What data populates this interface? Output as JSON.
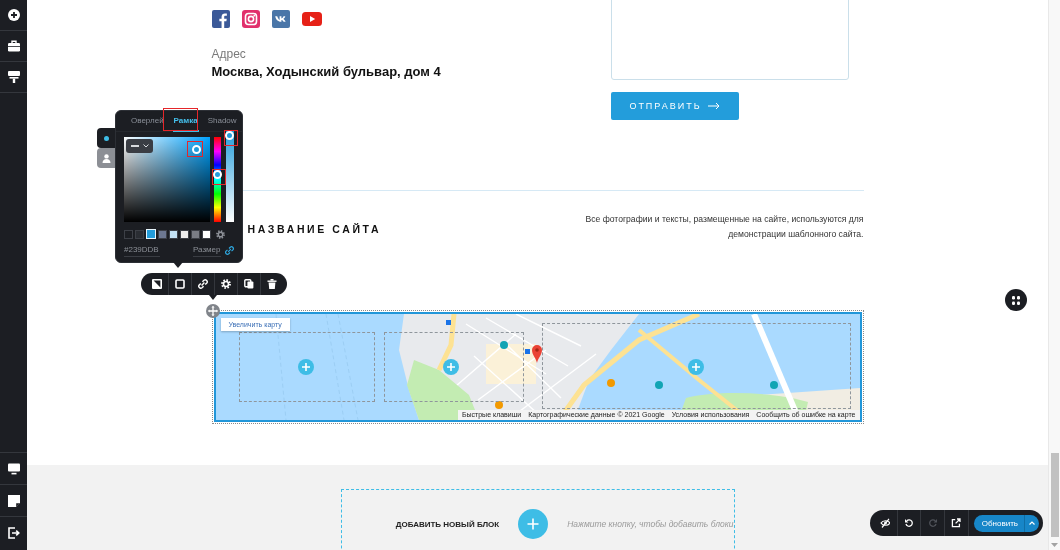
{
  "contacts": {
    "address_label": "Адрес",
    "address": "Москва, Ходынский бульвар, дом 4"
  },
  "contact_form": {
    "submit_label": "ОТПРАВИТЬ"
  },
  "footer": {
    "site_title": "НАЗВАНИЕ САЙТА",
    "disclaimer": "Все фотографии и тексты, размещенные на сайте, используются для демонстрации шаблонного сайта."
  },
  "map": {
    "expand_link": "Увеличить карту",
    "attribution": [
      "Быстрые клавиши",
      "Картографические данные © 2021 Google",
      "Условия использования",
      "Сообщить об ошибке на карте"
    ]
  },
  "style_popup": {
    "side_tabs": [
      {
        "selected": true
      },
      {
        "selected": false
      }
    ],
    "tabs": [
      {
        "label": "Оверлей",
        "selected": false
      },
      {
        "label": "Рамка",
        "selected": true
      },
      {
        "label": "Shadow",
        "selected": false
      }
    ],
    "hue_slider": {
      "level": 0.56
    },
    "opacity_slider": {
      "level": 1
    },
    "swatches": [
      {
        "color": "#1c1e23",
        "selected": false
      },
      {
        "color": "#2a2d33",
        "selected": false
      },
      {
        "color": "#239ddb",
        "selected": true
      },
      {
        "color": "#6d7891",
        "selected": false
      },
      {
        "color": "#c4e2f5",
        "selected": false
      },
      {
        "color": "#eeeeee",
        "selected": false
      },
      {
        "color": "#7a7d85",
        "selected": false
      },
      {
        "color": "#ffffff",
        "selected": false
      }
    ],
    "hex_value": "#239DDB",
    "size_label": "Размер"
  },
  "add_block": {
    "title": "ДОБАВИТЬ НОВЫЙ БЛОК",
    "hint": "Нажмите кнопку, чтобы добавить блоки"
  },
  "bottom_toolbar": {
    "tools": [
      {
        "disabled": false
      },
      {
        "disabled": false
      },
      {
        "disabled": true
      },
      {
        "disabled": false
      }
    ],
    "update_label": "Обновить"
  }
}
